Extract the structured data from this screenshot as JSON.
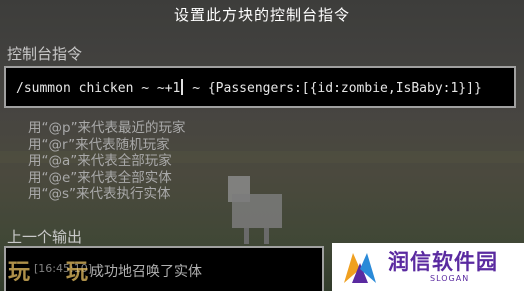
{
  "window": {
    "title": "设置此方块的控制台指令"
  },
  "command": {
    "label": "控制台指令",
    "value_before_cursor": "/summon chicken ~ ~+1",
    "value_after_cursor": " ~ {Passengers:[{id:zombie,IsBaby:1}]}"
  },
  "hints": [
    "用“@p”来代表最近的玩家",
    "用“@r”来代表随机玩家",
    "用“@a”来代表全部玩家",
    "用“@e”来代表全部实体",
    "用“@s”来代表执行实体"
  ],
  "output": {
    "label": "上一个输出",
    "message": "成功地召唤了实体"
  },
  "watermark": {
    "left": "玩",
    "right": "玩",
    "middle": "[16:45:10]"
  },
  "brand": {
    "name": "润信软件园",
    "slogan": "SLOGAN",
    "color": "#5a2aa0"
  }
}
